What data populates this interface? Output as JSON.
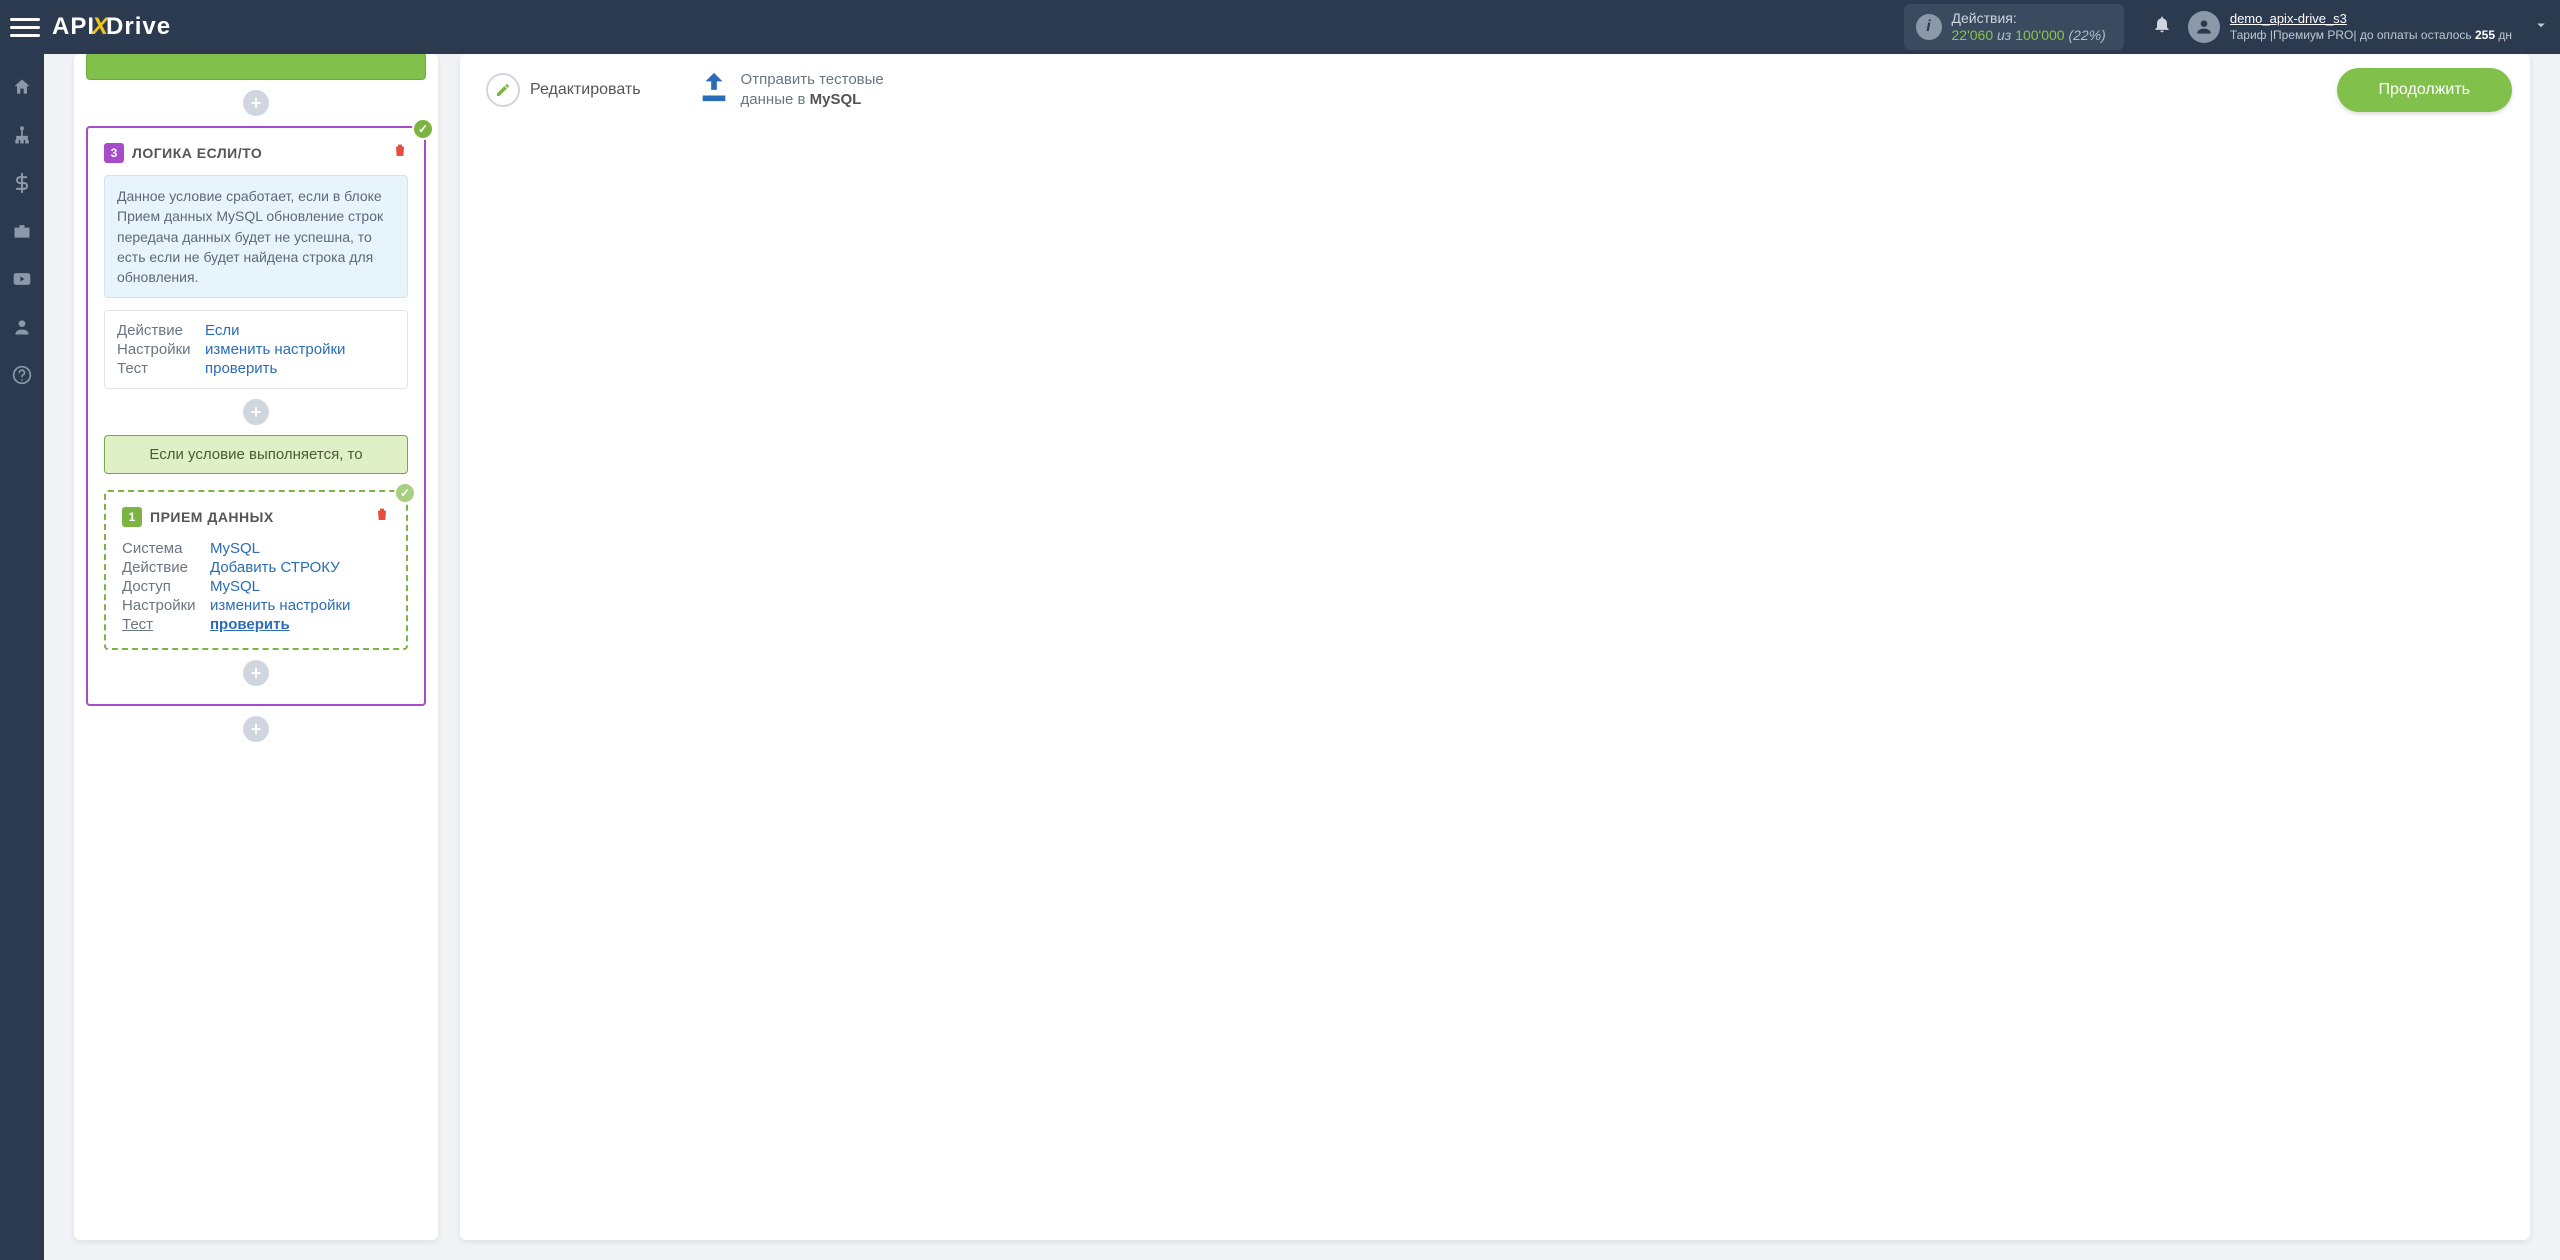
{
  "header": {
    "logo_api": "API",
    "logo_drive": "Drive",
    "actions_label": "Действия:",
    "actions_used": "22'060",
    "actions_of": "из",
    "actions_max": "100'000",
    "actions_pct": "(22%)",
    "user_name": "demo_apix-drive_s3",
    "tariff_prefix": "Тариф |Премиум PRO| до оплаты осталось ",
    "tariff_days": "255",
    "tariff_suffix": " дн"
  },
  "left": {
    "step3": {
      "num": "3",
      "title": "ЛОГИКА ЕСЛИ/ТО",
      "info": "Данное условие сработает, если в блоке Прием данных MySQL обновление строк передача данных будет не успешна, то есть если не будет найдена строка для обновления.",
      "rows": {
        "action_k": "Действие",
        "action_v": "Если",
        "settings_k": "Настройки",
        "settings_v": "изменить настройки",
        "test_k": "Тест",
        "test_v": "проверить"
      },
      "cond": "Если условие выполняется, то"
    },
    "step1": {
      "num": "1",
      "title": "ПРИЕМ ДАННЫХ",
      "rows": {
        "system_k": "Система",
        "system_v": "MySQL",
        "action_k": "Действие",
        "action_v": "Добавить СТРОКУ",
        "access_k": "Доступ",
        "access_v": "MySQL",
        "settings_k": "Настройки",
        "settings_v": "изменить настройки",
        "test_k": "Тест",
        "test_v": "проверить"
      }
    }
  },
  "right": {
    "edit": "Редактировать",
    "send_line1": "Отправить тестовые",
    "send_line2_prefix": "данные в ",
    "send_line2_bold": "MySQL",
    "continue": "Продолжить"
  }
}
